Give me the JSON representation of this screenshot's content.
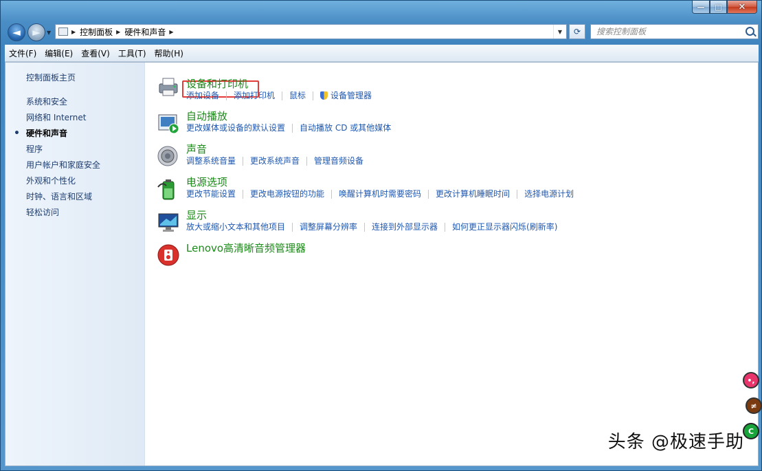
{
  "window": {
    "caption_buttons": {
      "minimize": "—",
      "maximize": "□",
      "close": "✕"
    }
  },
  "navbar": {
    "back": "◄",
    "forward": "►",
    "breadcrumb": [
      "控制面板",
      "硬件和声音"
    ],
    "refresh": "⟳",
    "search": {
      "placeholder": "搜索控制面板"
    }
  },
  "menubar": {
    "items": [
      "文件(F)",
      "编辑(E)",
      "查看(V)",
      "工具(T)",
      "帮助(H)"
    ]
  },
  "sidebar": {
    "home": "控制面板主页",
    "items": [
      {
        "label": "系统和安全"
      },
      {
        "label": "网络和 Internet"
      },
      {
        "label": "硬件和声音",
        "active": true
      },
      {
        "label": "程序"
      },
      {
        "label": "用户帐户和家庭安全"
      },
      {
        "label": "外观和个性化"
      },
      {
        "label": "时钟、语言和区域"
      },
      {
        "label": "轻松访问"
      }
    ]
  },
  "categories": [
    {
      "title": "设备和打印机",
      "icon": "printer-icon",
      "links": [
        "添加设备",
        "添加打印机",
        "鼠标",
        "设备管理器"
      ]
    },
    {
      "title": "自动播放",
      "icon": "autoplay-icon",
      "links": [
        "更改媒体或设备的默认设置",
        "自动播放 CD 或其他媒体"
      ]
    },
    {
      "title": "声音",
      "icon": "speaker-icon",
      "links": [
        "调整系统音量",
        "更改系统声音",
        "管理音频设备"
      ]
    },
    {
      "title": "电源选项",
      "icon": "battery-icon",
      "links": [
        "更改节能设置",
        "更改电源按钮的功能",
        "唤醒计算机时需要密码",
        "更改计算机睡眠时间",
        "选择电源计划"
      ]
    },
    {
      "title": "显示",
      "icon": "monitor-icon",
      "links": [
        "放大或缩小文本和其他项目",
        "调整屏幕分辨率",
        "连接到外部显示器",
        "如何更正显示器闪烁(刷新率)"
      ]
    },
    {
      "title": "Lenovo高清晰音频管理器",
      "icon": "audio-manager-icon",
      "links": []
    }
  ],
  "float_buttons": [
    "•,",
    "≠",
    "C"
  ],
  "watermark": "头条 @极速手助",
  "colors": {
    "title_green": "#1b8a18",
    "link_blue": "#1f58b0",
    "highlight_red": "#e33a3a"
  }
}
